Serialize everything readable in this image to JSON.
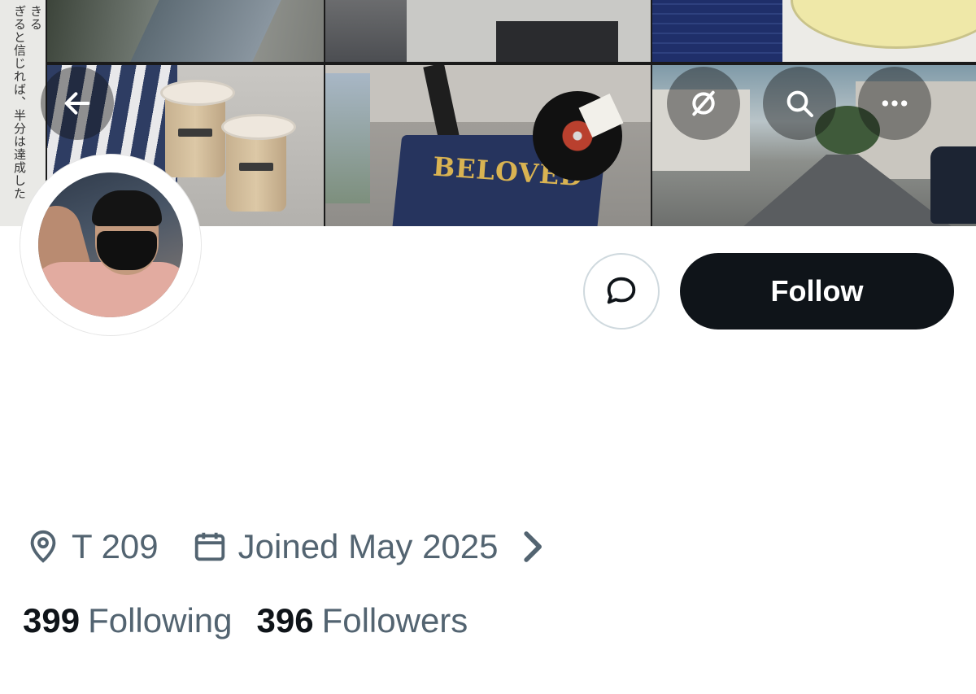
{
  "banner": {
    "side_text_1": "ぎると信じれば、半分は達成した",
    "side_text_2": "きる",
    "mat_text": "BELOVED",
    "icons": {
      "back": "arrow-left-icon",
      "translate": "translate-icon",
      "search": "search-icon",
      "more": "more-horizontal-icon"
    }
  },
  "profile": {
    "avatar_icon": "avatar"
  },
  "actions": {
    "message_icon": "message-bubble-icon",
    "follow_label": "Follow"
  },
  "meta": {
    "location_icon": "location-pin-icon",
    "location": "T 209",
    "joined_icon": "calendar-icon",
    "joined": "Joined May 2025",
    "expand_icon": "chevron-right-icon"
  },
  "stats": {
    "following_count": "399",
    "following_label": "Following",
    "followers_count": "396",
    "followers_label": "Followers"
  },
  "colors": {
    "primary_text": "#0f1419",
    "secondary_text": "#536471",
    "follow_button_bg": "#0f1419",
    "border": "#cfd9de"
  }
}
